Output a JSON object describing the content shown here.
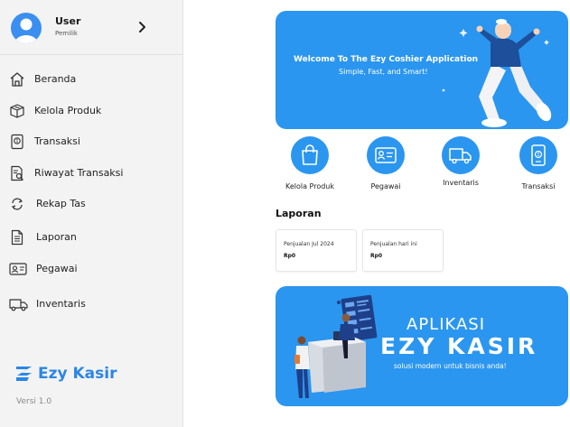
{
  "sidebar": {
    "user": {
      "name": "User",
      "role": "Pemilik"
    },
    "items": [
      {
        "label": "Beranda",
        "icon": "home-icon"
      },
      {
        "label": "Kelola Produk",
        "icon": "box-icon"
      },
      {
        "label": "Transaksi",
        "icon": "receipt-icon"
      },
      {
        "label": "Riwayat Transaksi",
        "icon": "document-search-icon"
      },
      {
        "label": "Rekap Tas",
        "icon": "refresh-icon"
      },
      {
        "label": "Laporan",
        "icon": "document-icon"
      },
      {
        "label": "Pegawai",
        "icon": "id-card-icon"
      },
      {
        "label": "Inventaris",
        "icon": "truck-icon"
      }
    ],
    "brand": "Ezy Kasir",
    "version": "Versi 1.0"
  },
  "banner": {
    "title": "Welcome To The Ezy Coshier Application",
    "subtitle": "Simple, Fast, and Smart!"
  },
  "quick_actions": [
    {
      "label": "Kelola Produk",
      "icon": "shopping-bag-icon"
    },
    {
      "label": "Pegawai",
      "icon": "id-card-icon"
    },
    {
      "label": "Inventaris",
      "icon": "truck-icon"
    },
    {
      "label": "Transaksi",
      "icon": "phone-receipt-icon"
    }
  ],
  "report": {
    "title": "Laporan",
    "cards": [
      {
        "title": "Penjualan Jul 2024",
        "value": "Rp0"
      },
      {
        "title": "Penjualan hari ini",
        "value": "Rp0"
      }
    ]
  },
  "promo": {
    "line1": "APLIKASI",
    "line2": "EZY KASIR",
    "line3": "solusi modern untuk bisnis anda!"
  },
  "colors": {
    "accent": "#2b96ef",
    "sidebar_bg": "#f3f3f3",
    "brand": "#2a86e6"
  }
}
